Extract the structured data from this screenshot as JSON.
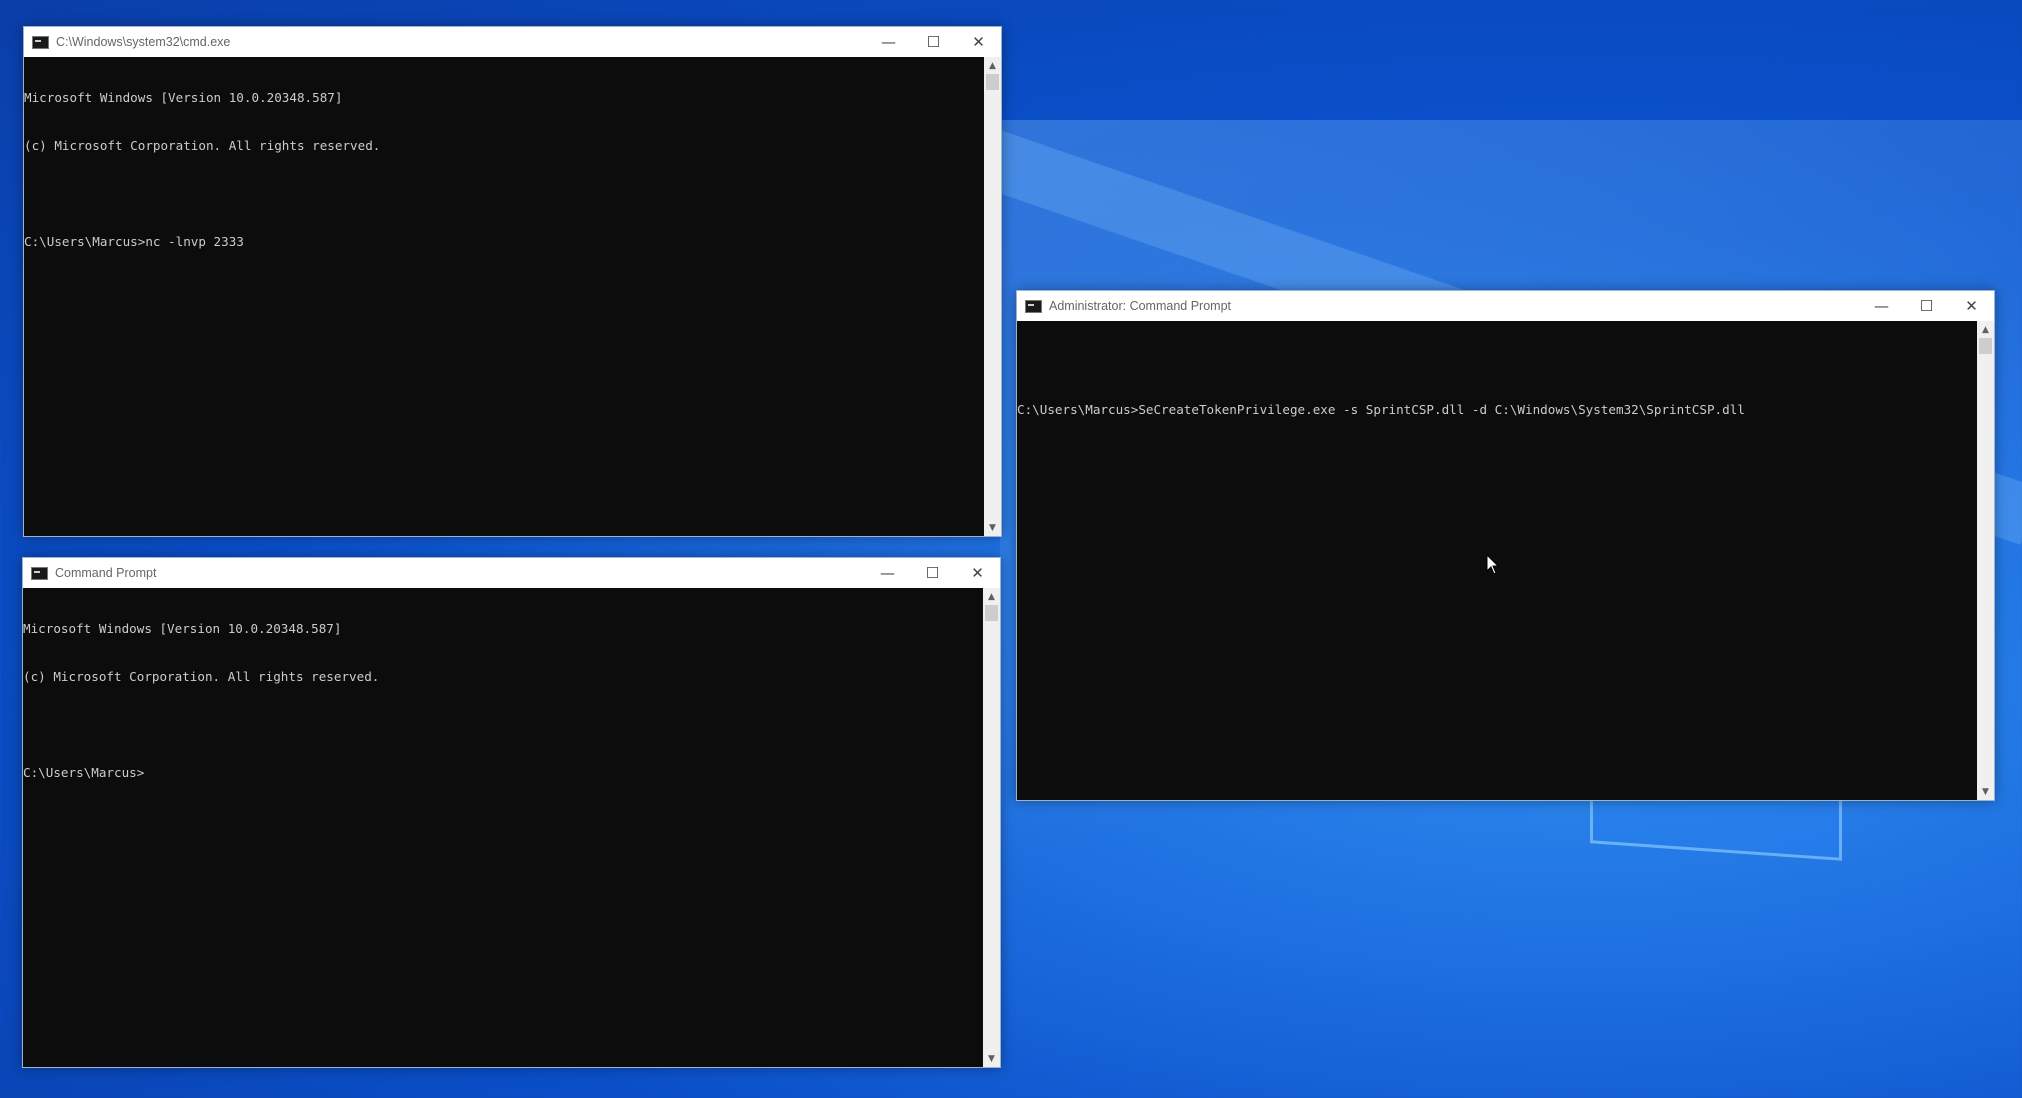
{
  "desktop": {
    "background": "#1565d8"
  },
  "windows": [
    {
      "id": "nc-window",
      "title": "C:\\Windows\\system32\\cmd.exe",
      "lines": [
        "Microsoft Windows [Version 10.0.20348.587]",
        "(c) Microsoft Corporation. All rights reserved.",
        "",
        "C:\\Users\\Marcus>nc -lnvp 2333"
      ]
    },
    {
      "id": "cmd-window",
      "title": "Command Prompt",
      "lines": [
        "Microsoft Windows [Version 10.0.20348.587]",
        "(c) Microsoft Corporation. All rights reserved.",
        "",
        "C:\\Users\\Marcus>"
      ]
    },
    {
      "id": "admin-window",
      "title": "Administrator: Command Prompt",
      "lines": [
        "",
        "C:\\Users\\Marcus>SeCreateTokenPrivilege.exe -s SprintCSP.dll -d C:\\Windows\\System32\\SprintCSP.dll"
      ]
    }
  ],
  "caption_buttons": {
    "minimize": "—",
    "maximize": "☐",
    "close": "✕"
  },
  "scroll_arrows": {
    "up": "▲",
    "down": "▼"
  },
  "colors": {
    "terminal_bg": "#0c0c0c",
    "terminal_fg": "#cccccc",
    "titlebar_bg": "#ffffff"
  }
}
